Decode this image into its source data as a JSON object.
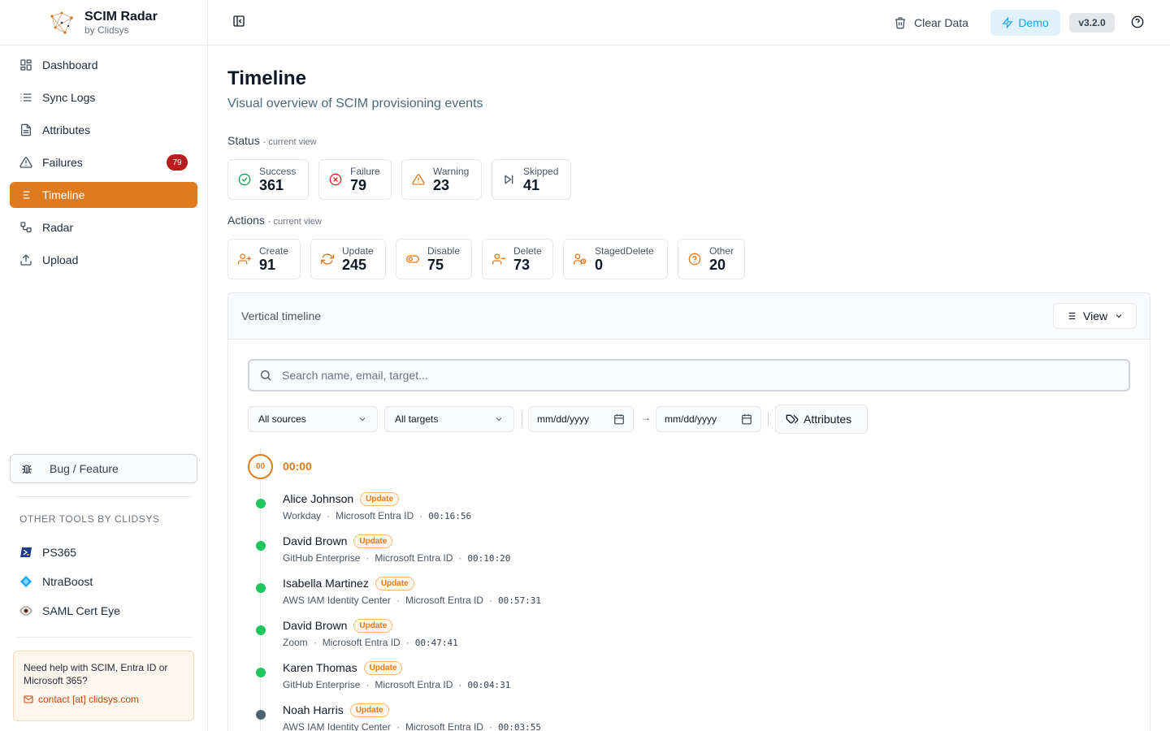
{
  "app": {
    "title": "SCIM Radar",
    "subtitle": "by Clidsys"
  },
  "sidebar": {
    "items": [
      {
        "label": "Dashboard",
        "icon": "dashboard-icon"
      },
      {
        "label": "Sync Logs",
        "icon": "list-icon"
      },
      {
        "label": "Attributes",
        "icon": "file-text-icon"
      },
      {
        "label": "Failures",
        "icon": "alert-triangle-icon",
        "badge": "79"
      },
      {
        "label": "Timeline",
        "icon": "timeline-icon",
        "active": true
      },
      {
        "label": "Radar",
        "icon": "workflow-icon"
      },
      {
        "label": "Upload",
        "icon": "upload-icon"
      }
    ],
    "bug_label": "Bug / Feature",
    "tools_title": "Other tools by Clidsys",
    "tools": [
      {
        "label": "PS365",
        "icon": "powershell-icon"
      },
      {
        "label": "NtraBoost",
        "icon": "diamond-icon"
      },
      {
        "label": "SAML Cert Eye",
        "icon": "eye-icon"
      }
    ],
    "help": {
      "text": "Need help with SCIM, Entra ID or Microsoft 365?",
      "contact": "contact [at] clidsys.com"
    }
  },
  "topbar": {
    "clear_label": "Clear Data",
    "demo_label": "Demo",
    "version": "v3.2.0"
  },
  "page": {
    "title": "Timeline",
    "subtitle": "Visual overview of SCIM provisioning events"
  },
  "status": {
    "label": "Status",
    "note": "- current view",
    "cards": [
      {
        "label": "Success",
        "value": "361",
        "color": "#16a34a"
      },
      {
        "label": "Failure",
        "value": "79",
        "color": "#dc2626"
      },
      {
        "label": "Warning",
        "value": "23",
        "color": "#e07a1f"
      },
      {
        "label": "Skipped",
        "value": "41",
        "color": "#4b5563"
      }
    ]
  },
  "actions": {
    "label": "Actions",
    "note": "- current view",
    "cards": [
      {
        "label": "Create",
        "value": "91"
      },
      {
        "label": "Update",
        "value": "245"
      },
      {
        "label": "Disable",
        "value": "75"
      },
      {
        "label": "Delete",
        "value": "73"
      },
      {
        "label": "StagedDelete",
        "value": "0"
      },
      {
        "label": "Other",
        "value": "20"
      }
    ]
  },
  "panel": {
    "title": "Vertical timeline",
    "view_label": "View",
    "search_placeholder": "Search name, email, target...",
    "sources_value": "All sources",
    "targets_value": "All targets",
    "date_from_placeholder": "mm/dd/yyyy",
    "date_to_placeholder": "mm/dd/yyyy",
    "arrow": "→",
    "attributes_label": "Attributes"
  },
  "timeline": {
    "hour_badge": "00",
    "hour_label": "00:00",
    "events": [
      {
        "name": "Alice Johnson",
        "action": "Update",
        "source": "Workday",
        "target": "Microsoft Entra ID",
        "time": "00:16:56",
        "status_color": "#22c55e"
      },
      {
        "name": "David Brown",
        "action": "Update",
        "source": "GitHub Enterprise",
        "target": "Microsoft Entra ID",
        "time": "00:10:20",
        "status_color": "#22c55e"
      },
      {
        "name": "Isabella Martinez",
        "action": "Update",
        "source": "AWS IAM Identity Center",
        "target": "Microsoft Entra ID",
        "time": "00:57:31",
        "status_color": "#22c55e"
      },
      {
        "name": "David Brown",
        "action": "Update",
        "source": "Zoom",
        "target": "Microsoft Entra ID",
        "time": "00:47:41",
        "status_color": "#22c55e"
      },
      {
        "name": "Karen Thomas",
        "action": "Update",
        "source": "GitHub Enterprise",
        "target": "Microsoft Entra ID",
        "time": "00:04:31",
        "status_color": "#22c55e"
      },
      {
        "name": "Noah Harris",
        "action": "Update",
        "source": "AWS IAM Identity Center",
        "target": "Microsoft Entra ID",
        "time": "00:03:55",
        "status_color": "#4b6470"
      }
    ]
  }
}
